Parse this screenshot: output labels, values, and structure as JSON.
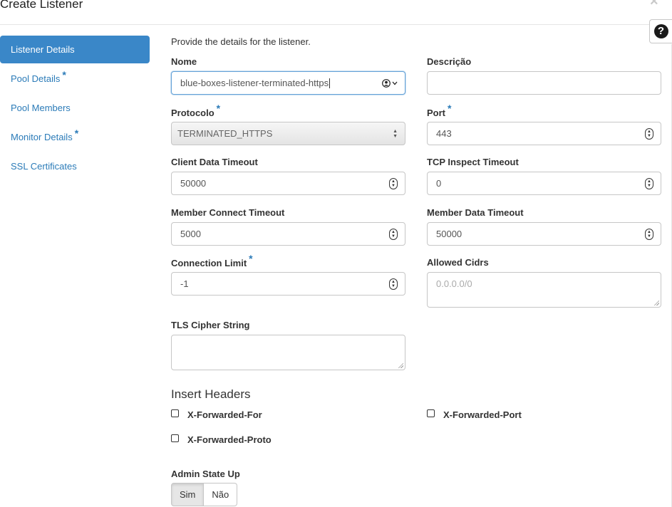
{
  "modal": {
    "title": "Create Listener",
    "close_glyph": "×",
    "help_glyph": "?"
  },
  "sidebar": {
    "items": [
      {
        "label": "Listener Details",
        "active": true,
        "required": false
      },
      {
        "label": "Pool Details",
        "active": false,
        "required": true
      },
      {
        "label": "Pool Members",
        "active": false,
        "required": false
      },
      {
        "label": "Monitor Details",
        "active": false,
        "required": true
      },
      {
        "label": "SSL Certificates",
        "active": false,
        "required": false
      }
    ],
    "required_marker": "*"
  },
  "form": {
    "intro": "Provide the details for the listener.",
    "name": {
      "label": "Nome",
      "value": "blue-boxes-listener-terminated-https"
    },
    "description": {
      "label": "Descrição",
      "value": ""
    },
    "protocol": {
      "label": "Protocolo",
      "value": "TERMINATED_HTTPS"
    },
    "port": {
      "label": "Port",
      "value": "443"
    },
    "client_data_timeout": {
      "label": "Client Data Timeout",
      "value": "50000"
    },
    "tcp_inspect_timeout": {
      "label": "TCP Inspect Timeout",
      "value": "0"
    },
    "member_connect_timeout": {
      "label": "Member Connect Timeout",
      "value": "5000"
    },
    "member_data_timeout": {
      "label": "Member Data Timeout",
      "value": "50000"
    },
    "connection_limit": {
      "label": "Connection Limit",
      "value": "-1"
    },
    "allowed_cidrs": {
      "label": "Allowed Cidrs",
      "placeholder": "0.0.0.0/0"
    },
    "tls_cipher_string": {
      "label": "TLS Cipher String",
      "value": ""
    },
    "insert_headers": {
      "title": "Insert Headers",
      "options": [
        {
          "label": "X-Forwarded-For",
          "checked": false
        },
        {
          "label": "X-Forwarded-Port",
          "checked": false
        },
        {
          "label": "X-Forwarded-Proto",
          "checked": false
        }
      ]
    },
    "admin_state": {
      "label": "Admin State Up",
      "options": [
        "Sim",
        "Não"
      ],
      "selected": "Sim"
    }
  },
  "colors": {
    "accent": "#3a87c8",
    "link": "#2b7bb8",
    "border": "#c6c6c6"
  },
  "icons": {
    "close": "close-icon",
    "help": "help-icon",
    "spinner": "number-spinner-icon",
    "select": "select-arrows-icon",
    "autofill": "autofill-contact-icon"
  }
}
